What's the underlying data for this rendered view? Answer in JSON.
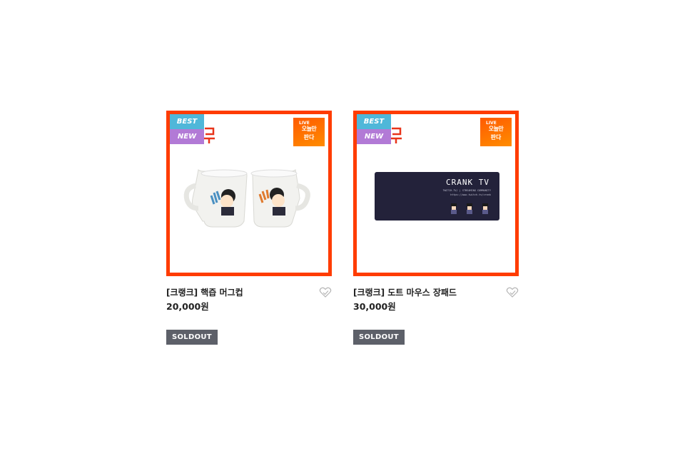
{
  "products": [
    {
      "badges": {
        "best": "BEST",
        "new": "NEW"
      },
      "sticker": {
        "top": "LIVE",
        "line1": "오늘만",
        "line2": "판다"
      },
      "name": "[크랭크] 핵즙 머그컵",
      "price": "20,000원",
      "status": "SOLDOUT"
    },
    {
      "badges": {
        "best": "BEST",
        "new": "NEW"
      },
      "sticker": {
        "top": "LIVE",
        "line1": "오늘만",
        "line2": "판다"
      },
      "name": "[크랭크] 도트 마우스 장패드",
      "price": "30,000원",
      "status": "SOLDOUT",
      "pad": {
        "title": "CRANK TV",
        "sub1": "TWITCH.TV/ | STREAMING COMMUNITY",
        "sub2": "https://www.twitch.tv/crank"
      }
    }
  ],
  "colors": {
    "frame": "#ff3c00",
    "best": "#4fb7d9",
    "new": "#b27ad6",
    "soldout": "#5d6069"
  },
  "icons": {
    "wish": "heart-icon"
  }
}
